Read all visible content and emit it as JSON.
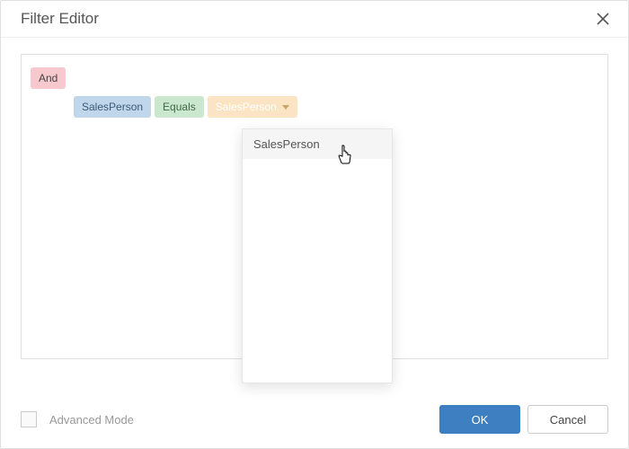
{
  "header": {
    "title": "Filter Editor"
  },
  "filter": {
    "group_operator": "And",
    "condition": {
      "field": "SalesPerson",
      "operator": "Equals",
      "value": "SalesPerson"
    }
  },
  "dropdown": {
    "options": [
      "SalesPerson"
    ]
  },
  "footer": {
    "advanced_label": "Advanced Mode",
    "ok_label": "OK",
    "cancel_label": "Cancel"
  }
}
